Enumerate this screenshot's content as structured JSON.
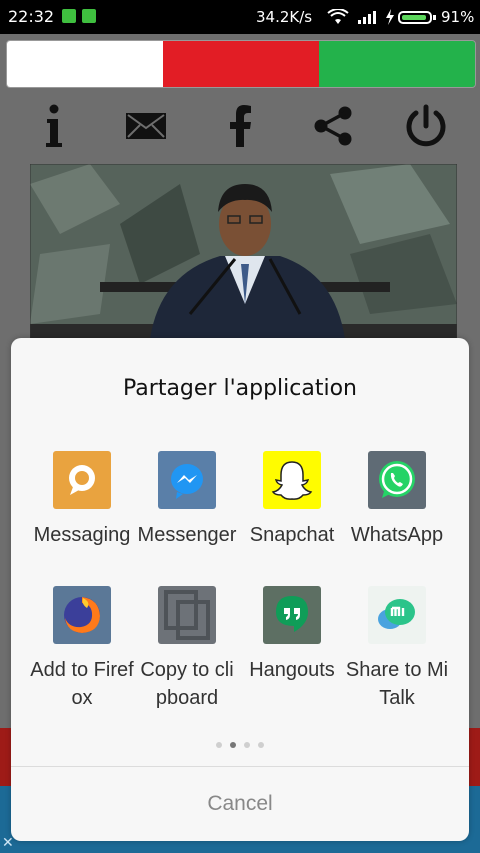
{
  "status_bar": {
    "time": "22:32",
    "network_speed": "34.2K/s",
    "battery_percent": "91%",
    "battery_level": 0.91
  },
  "flag": {
    "stripe_colors": [
      "#ffffff",
      "#e21d25",
      "#23b24b"
    ]
  },
  "toolbar": {
    "icons": [
      "info-icon",
      "mail-icon",
      "facebook-icon",
      "share-icon",
      "power-icon"
    ]
  },
  "share_dialog": {
    "title": "Partager  l'application",
    "apps": [
      {
        "label": "Messaging",
        "icon": "messaging-icon",
        "color": "#f0a63a"
      },
      {
        "label": "Messenger",
        "icon": "messenger-icon",
        "color": "#1e88e5"
      },
      {
        "label": "Snapchat",
        "icon": "snapchat-icon",
        "color": "#fffc00"
      },
      {
        "label": "WhatsApp",
        "icon": "whatsapp-icon",
        "color": "#25d366"
      },
      {
        "label": "Add to Firefox",
        "icon": "firefox-icon",
        "color": "#ff7139"
      },
      {
        "label": "Copy to clipboard",
        "icon": "clipboard-icon",
        "color": "#7a7a7a"
      },
      {
        "label": "Hangouts",
        "icon": "hangouts-icon",
        "color": "#0f9d58"
      },
      {
        "label": "Share to Mi Talk",
        "icon": "mi-talk-icon",
        "color": "#2bc48a"
      }
    ],
    "page_indicator": {
      "pages": 4,
      "active": 1
    },
    "cancel_label": "Cancel"
  }
}
